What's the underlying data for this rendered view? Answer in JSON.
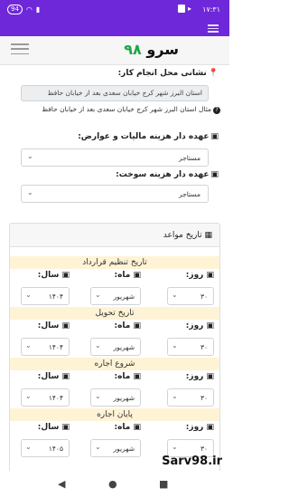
{
  "status": {
    "time": "۱۷:۳۱",
    "battery_pill": "94"
  },
  "brand": {
    "name": "سرو",
    "num": "۹۸"
  },
  "form": {
    "location_label": "نشانی محل انجام کار:",
    "location_value": "استان البرز شهر کرج خیابان سعدی بعد از خیابان حافظ",
    "location_help": "مثال استان البرز شهر کرج خیابان سعدی بعد از خیابان حافظ",
    "tax_label": "عهده دار هزینه مالیات و عوارض:",
    "tax_value": "مستاجر",
    "fuel_label": "عهده دار هزینه سوخت:",
    "fuel_value": "مستاجر"
  },
  "dates_card": {
    "title": "تاریخ مواعد",
    "day_label": "روز:",
    "month_label": "ماه:",
    "year_label": "سال:",
    "sections": [
      {
        "title": "تاریخ تنظیم قرارداد",
        "day": "۳۰",
        "month": "شهریور",
        "year": "۱۴۰۴"
      },
      {
        "title": "تاریخ تحویل",
        "day": "۳۰",
        "month": "شهریور",
        "year": "۱۴۰۴"
      },
      {
        "title": "شروع اجاره",
        "day": "۳۰",
        "month": "شهریور",
        "year": "۱۴۰۴"
      },
      {
        "title": "پایان اجاره",
        "day": "۳۰",
        "month": "شهریور",
        "year": "۱۴۰۵"
      }
    ]
  },
  "watermark": "Sarv98.ir",
  "icons": [
    "pin-icon",
    "question-icon",
    "money-icon",
    "calendar-icon",
    "chevron-down-icon",
    "back-icon",
    "home-icon",
    "recents-icon"
  ]
}
